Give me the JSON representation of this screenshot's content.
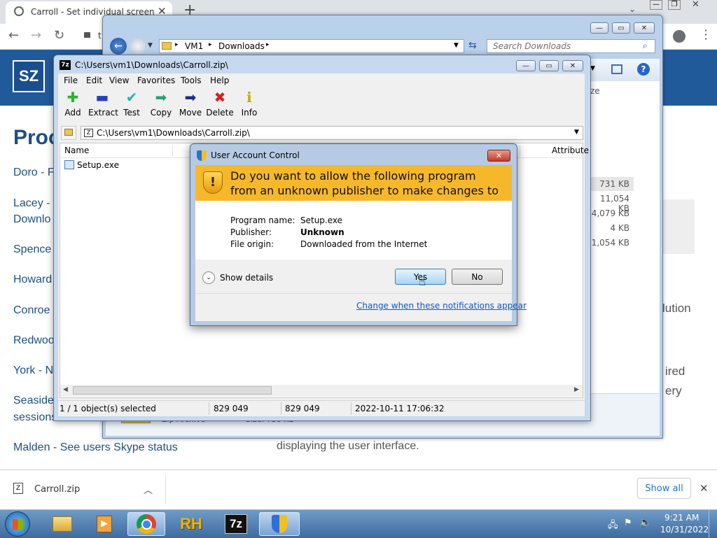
{
  "chrome": {
    "tab_title": "Carroll - Set individual screen re",
    "new_tab": "+",
    "url_prefix": "t",
    "download_file": "Carroll.zip",
    "show_all": "Show all"
  },
  "website": {
    "logo": "SZ",
    "heading": "Proc",
    "links": [
      "Doro - F",
      "Lacey -",
      "Downlo",
      "Spence",
      "Howard",
      "Conroe",
      "Redwoo",
      "York - N",
      "Seaside",
      "sessions",
      "Malden - See users Skype status"
    ],
    "body_lines": [
      "lution",
      "ired",
      "ery",
      "displaying the user interface."
    ]
  },
  "explorer": {
    "crumbs": [
      "VM1",
      "Downloads"
    ],
    "search_placeholder": "Search Downloads",
    "col_size_fragment": "ze",
    "sizes": [
      "731 KB",
      "11,054 KB",
      "4,079 KB",
      "4 KB",
      "1,054 KB"
    ],
    "details_type": "Zip Archive",
    "details_size": "Size: 730 KB"
  },
  "sevenzip": {
    "title": "C:\\Users\\vm1\\Downloads\\Carroll.zip\\",
    "menu": [
      "File",
      "Edit",
      "View",
      "Favorites",
      "Tools",
      "Help"
    ],
    "toolbar": [
      {
        "label": "Add",
        "icon": "✚",
        "color": "#2fb12f"
      },
      {
        "label": "Extract",
        "icon": "▬",
        "color": "#2a3fb8"
      },
      {
        "label": "Test",
        "icon": "✔",
        "color": "#20b8b0"
      },
      {
        "label": "Copy",
        "icon": "➡",
        "color": "#2aa07a"
      },
      {
        "label": "Move",
        "icon": "➡",
        "color": "#1b2c8f"
      },
      {
        "label": "Delete",
        "icon": "✖",
        "color": "#d41f1f"
      },
      {
        "label": "Info",
        "icon": "ℹ",
        "color": "#c8a800"
      }
    ],
    "path": "C:\\Users\\vm1\\Downloads\\Carroll.zip\\",
    "col_name": "Name",
    "col_attributes": "Attribute",
    "file": "Setup.exe",
    "status": [
      "1 / 1 object(s) selected",
      "829 049",
      "829 049",
      "2022-10-11 17:06:32"
    ]
  },
  "uac": {
    "title": "User Account Control",
    "question": "Do you want to allow the following program from an unknown publisher to make changes to this computer?",
    "rows": [
      {
        "label": "Program name:",
        "value": "Setup.exe"
      },
      {
        "label": "Publisher:",
        "value": "Unknown"
      },
      {
        "label": "File origin:",
        "value": "Downloaded from the Internet"
      }
    ],
    "show_details": "Show details",
    "yes": "Yes",
    "no": "No",
    "change_link": "Change when these notifications appear"
  },
  "taskbar": {
    "time": "9:21 AM",
    "date": "10/31/2022",
    "rh": "RH",
    "sevenzip": "7z"
  }
}
